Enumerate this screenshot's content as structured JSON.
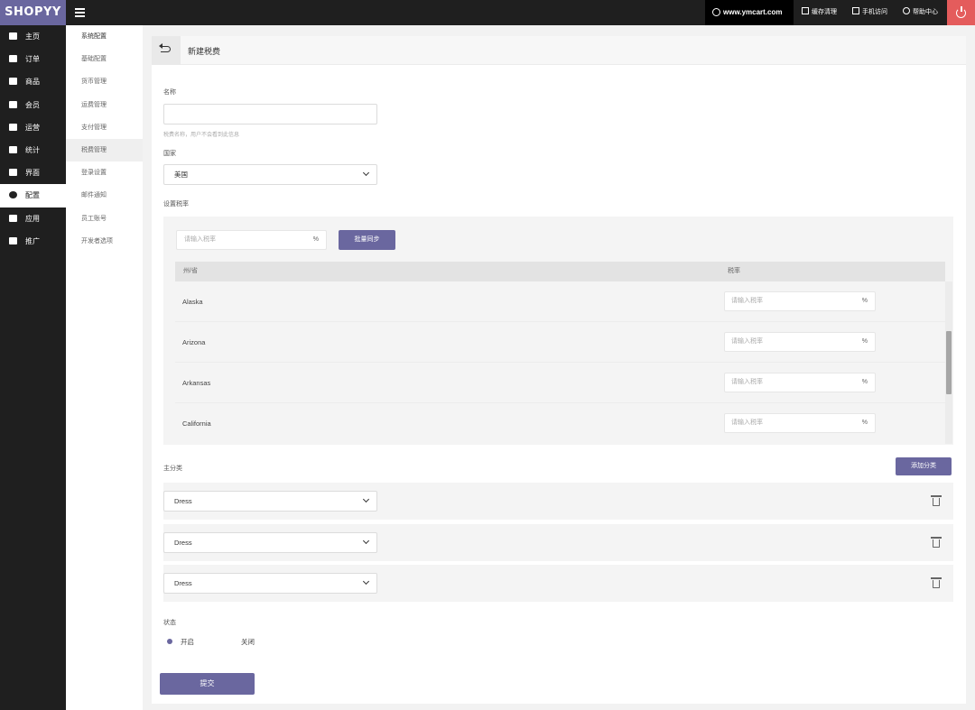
{
  "app": {
    "logo": "SHOPYY"
  },
  "header": {
    "site": "www.ymcart.com",
    "buttons": [
      {
        "label": "缓存清理",
        "icon": "trash-icon"
      },
      {
        "label": "手机访问",
        "icon": "mobile-icon"
      },
      {
        "label": "帮助中心",
        "icon": "help-icon"
      }
    ]
  },
  "nav": {
    "items": [
      {
        "label": "主页",
        "icon": "home-icon"
      },
      {
        "label": "订单",
        "icon": "order-icon"
      },
      {
        "label": "商品",
        "icon": "product-icon"
      },
      {
        "label": "会员",
        "icon": "user-icon"
      },
      {
        "label": "运营",
        "icon": "megaphone-icon"
      },
      {
        "label": "统计",
        "icon": "chart-icon"
      },
      {
        "label": "界面",
        "icon": "layout-icon"
      },
      {
        "label": "配置",
        "icon": "gear-icon",
        "active": true
      },
      {
        "label": "应用",
        "icon": "apps-icon"
      },
      {
        "label": "推广",
        "icon": "send-icon"
      }
    ]
  },
  "subnav": {
    "items": [
      {
        "label": "系统配置"
      },
      {
        "label": "基础配置"
      },
      {
        "label": "货币管理"
      },
      {
        "label": "运费管理"
      },
      {
        "label": "支付管理"
      },
      {
        "label": "税费管理",
        "active": true
      },
      {
        "label": "登录设置"
      },
      {
        "label": "邮件通知"
      },
      {
        "label": "员工账号"
      },
      {
        "label": "开发者选项"
      }
    ]
  },
  "page": {
    "title": "新建税费"
  },
  "form": {
    "name_label": "名称",
    "name_value": "",
    "name_hint": "税费名称，用户不会看到此信息",
    "country_label": "国家",
    "country_value": "美国",
    "rate_label": "设置税率",
    "batch_placeholder": "请输入税率",
    "percent": "%",
    "batch_button": "批量同步",
    "table_headers": {
      "state": "州/省",
      "rate": "税率"
    },
    "rows": [
      {
        "state": "Alaska",
        "rate_placeholder": "请输入税率"
      },
      {
        "state": "Arizona",
        "rate_placeholder": "请输入税率"
      },
      {
        "state": "Arkansas",
        "rate_placeholder": "请输入税率"
      },
      {
        "state": "California",
        "rate_placeholder": "请输入税率"
      }
    ],
    "category_label": "主分类",
    "add_category_button": "添加分类",
    "categories": [
      {
        "value": "Dress"
      },
      {
        "value": "Dress"
      },
      {
        "value": "Dress"
      }
    ],
    "status_label": "状态",
    "status_options": [
      {
        "label": "开启",
        "selected": true
      },
      {
        "label": "关闭",
        "selected": false
      }
    ],
    "submit_button": "提交"
  }
}
